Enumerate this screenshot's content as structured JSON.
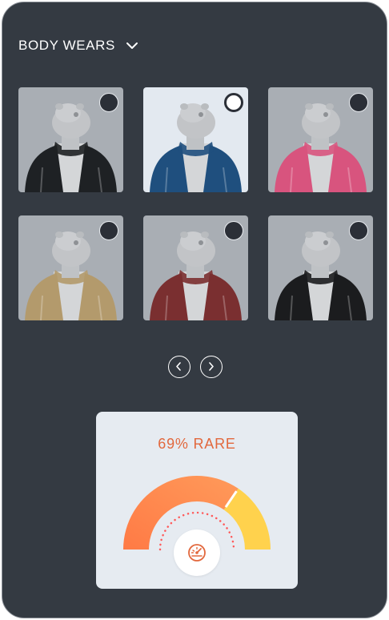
{
  "section": {
    "title": "BODY WEARS",
    "dropdown_icon": "chevron-down-icon"
  },
  "items": [
    {
      "name": "black puffer jacket",
      "color": "#1e2124",
      "selected": false
    },
    {
      "name": "blue puffer jacket",
      "color": "#1f4f7e",
      "selected": true
    },
    {
      "name": "pink puffer jacket",
      "color": "#d8547e",
      "selected": false
    },
    {
      "name": "tan hoodie",
      "color": "#b39a6c",
      "selected": false
    },
    {
      "name": "red camo puffer jacket",
      "color": "#7a2f30",
      "selected": false
    },
    {
      "name": "black smiley hoodie",
      "color": "#1b1c1e",
      "selected": false
    }
  ],
  "pagination": {
    "prev_icon": "chevron-left-icon",
    "next_icon": "chevron-right-icon"
  },
  "rarity": {
    "label": "69% RARE",
    "percent": 69,
    "gauge_icon": "speedometer-icon",
    "colors": {
      "low": "#ff7a45",
      "high": "#ffd24d",
      "text": "#e2683d"
    }
  }
}
